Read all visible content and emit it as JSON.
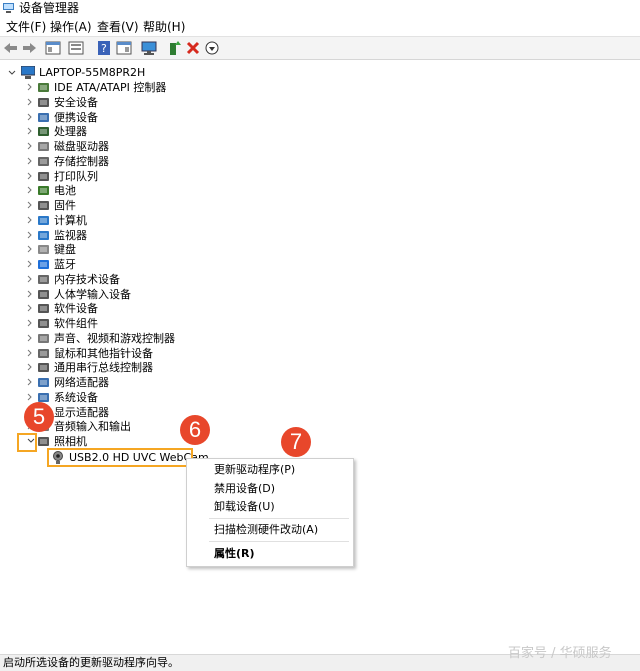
{
  "window": {
    "title": "设备管理器"
  },
  "menu": [
    "文件(F)",
    "操作(A)",
    "查看(V)",
    "帮助(H)"
  ],
  "toolbar": {
    "icons": [
      "back-arrow-icon",
      "forward-arrow-icon",
      "properties-view-icon",
      "list-view-icon",
      "help-icon",
      "detail-view-icon",
      "monitor-scan-icon",
      "add-driver-icon",
      "uninstall-x-icon",
      "download-circle-icon"
    ]
  },
  "tree": {
    "root": "LAPTOP-55M8PR2H",
    "items": [
      "IDE ATA/ATAPI 控制器",
      "安全设备",
      "便携设备",
      "处理器",
      "磁盘驱动器",
      "存储控制器",
      "打印队列",
      "电池",
      "固件",
      "计算机",
      "监视器",
      "键盘",
      "蓝牙",
      "内存技术设备",
      "人体学输入设备",
      "软件设备",
      "软件组件",
      "声音、视频和游戏控制器",
      "鼠标和其他指针设备",
      "通用串行总线控制器",
      "网络适配器",
      "系统设备",
      "显示适配器",
      "音频输入和输出",
      "照相机"
    ],
    "child": "USB2.0 HD UVC WebCam"
  },
  "context_menu": {
    "update": "更新驱动程序(P)",
    "disable": "禁用设备(D)",
    "uninstall": "卸载设备(U)",
    "scan": "扫描检测硬件改动(A)",
    "properties": "属性(R)"
  },
  "markers": {
    "m5": "5",
    "m6": "6",
    "m7": "7"
  },
  "status": "启动所选设备的更新驱动程序向导。",
  "watermark": "百家号 / 华硕服务",
  "colors": {
    "marker": "#e8472b",
    "highlight": "#f5a623"
  }
}
